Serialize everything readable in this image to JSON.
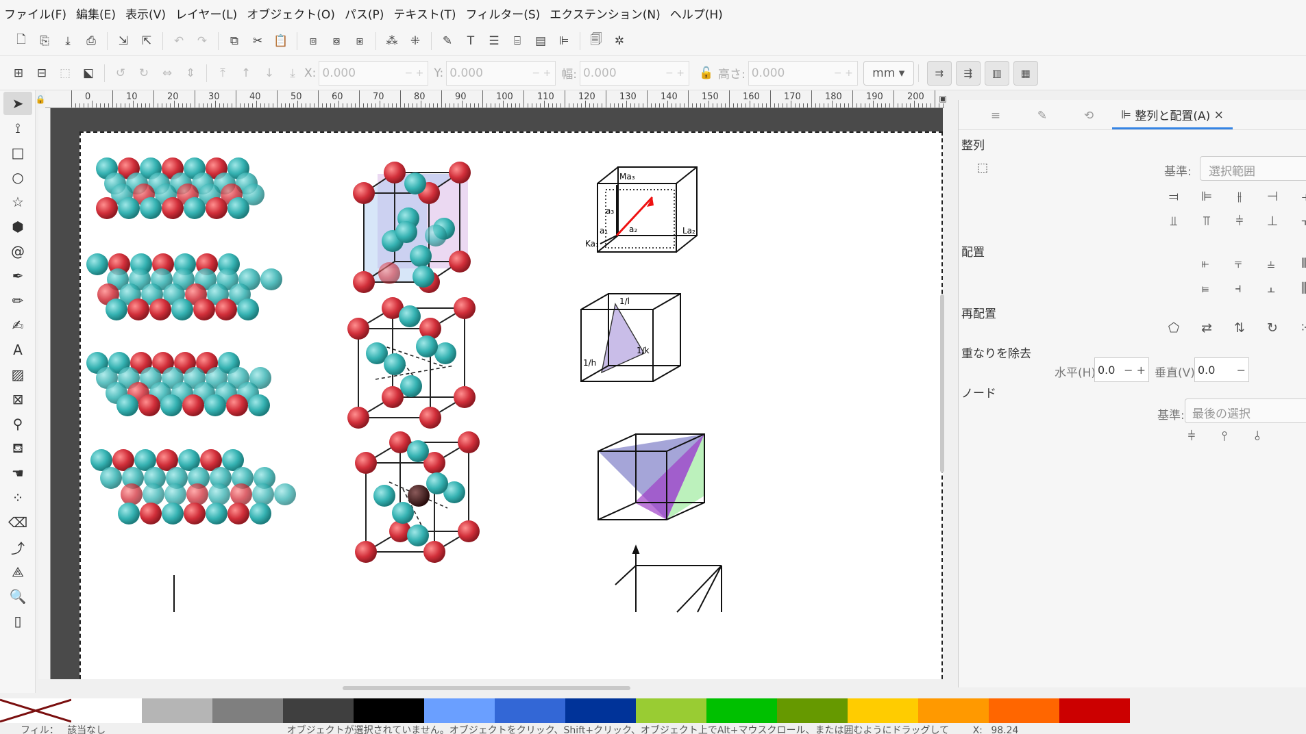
{
  "menu": [
    "ファイル(F)",
    "編集(E)",
    "表示(V)",
    "レイヤー(L)",
    "オブジェクト(O)",
    "パス(P)",
    "テキスト(T)",
    "フィルター(S)",
    "エクステンション(N)",
    "ヘルプ(H)"
  ],
  "toolbar2": {
    "x_label": "X:",
    "x_value": "0.000",
    "y_label": "Y:",
    "y_value": "0.000",
    "w_label": "幅:",
    "w_value": "0.000",
    "h_label": "高さ:",
    "h_value": "0.000",
    "unit": "mm"
  },
  "ruler_labels": [
    "0",
    "10",
    "20",
    "30",
    "40",
    "50",
    "60",
    "70",
    "80",
    "90",
    "100",
    "110",
    "120",
    "130",
    "140",
    "150",
    "160",
    "170",
    "180",
    "190",
    "200"
  ],
  "panel": {
    "tab_active": "整列と配置(A)",
    "close": "×",
    "align_heading": "整列",
    "relative_label": "基準:",
    "relative_value": "選択範囲",
    "distribute_heading": "配置",
    "rearrange_heading": "再配置",
    "overlap_heading": "重なりを除去",
    "h_label": "水平(H):",
    "h_value": "0.0",
    "v_label": "垂直(V):",
    "v_value": "0.0",
    "nodes_heading": "ノード",
    "nodes_relative_label": "基準:",
    "nodes_relative_value": "最後の選択"
  },
  "diagram_labels": {
    "ma3": "Ma₃",
    "la2": "La₂",
    "ka1": "Ka₁",
    "a1": "a₁",
    "a2": "a₂",
    "a3": "a₃",
    "one_l": "1/l",
    "one_k": "1/k",
    "one_h": "1/h"
  },
  "palette_colors": [
    "#ffffff",
    "#b5b5b5",
    "#7f7f7f",
    "#3f3f3f",
    "#000000",
    "#6a9fff",
    "#3367d6",
    "#003399",
    "#99cc33",
    "#00c000",
    "#669900",
    "#ffcc00",
    "#ff9900",
    "#ff6600",
    "#cc0000"
  ],
  "statusbar": {
    "layer": "フィル：",
    "layer2": "該当なし",
    "message": "オブジェクトが選択されていません。オブジェクトをクリック、Shift+クリック、オブジェクト上でAlt+マウスクロール、または囲むようにドラッグして",
    "x_readout": "X:",
    "x_value": "98.24"
  }
}
